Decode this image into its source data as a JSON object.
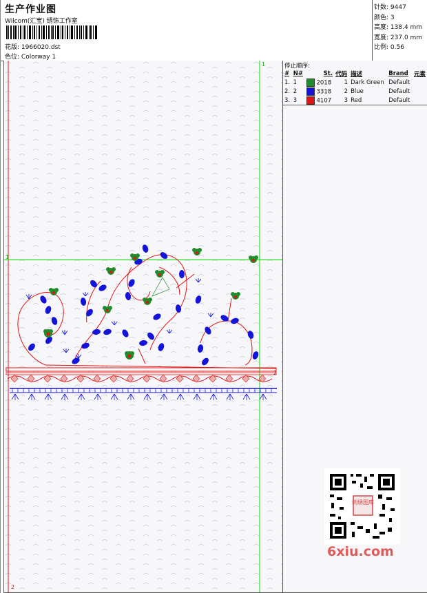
{
  "header": {
    "title": "生产作业图",
    "company": "Wilcom(汇宝) 绣饰工作室",
    "design_label": "花版:",
    "design_value": "1966020.dst",
    "colorway_label": "色位:",
    "colorway_value": "Colorway 1"
  },
  "stats": [
    {
      "label": "针数:",
      "value": "9447"
    },
    {
      "label": "颜色:",
      "value": "3"
    },
    {
      "label": "高度:",
      "value": "138.4 mm"
    },
    {
      "label": "宽度:",
      "value": "237.0 mm"
    },
    {
      "label": "比例:",
      "value": "0.56"
    }
  ],
  "canvas": {
    "guide_label_top": "1",
    "guide_label_left": "1",
    "guide_label_right": "2",
    "guide_label_bottom": "2"
  },
  "sequence": {
    "title": "停止顺序:",
    "columns": [
      "#",
      "N#",
      "St.",
      "代码",
      "描述",
      "Brand",
      "元素"
    ],
    "rows": [
      {
        "idx": "1.",
        "n": "1",
        "color": "#1e8c2a",
        "st": "2018",
        "code": "1",
        "desc": "Dark Green",
        "brand": "Default"
      },
      {
        "idx": "2.",
        "n": "2",
        "color": "#1414d8",
        "st": "3318",
        "code": "2",
        "desc": "Blue",
        "brand": "Default"
      },
      {
        "idx": "3.",
        "n": "3",
        "color": "#e01414",
        "st": "4107",
        "code": "3",
        "desc": "Red",
        "brand": "Default"
      }
    ]
  },
  "watermark": {
    "site": "6xiu.com",
    "stamp": "刺绣图库"
  },
  "colors": {
    "guide": "#00dd00",
    "red": "#e01414",
    "blue": "#1414d8",
    "green": "#1e8c2a"
  }
}
